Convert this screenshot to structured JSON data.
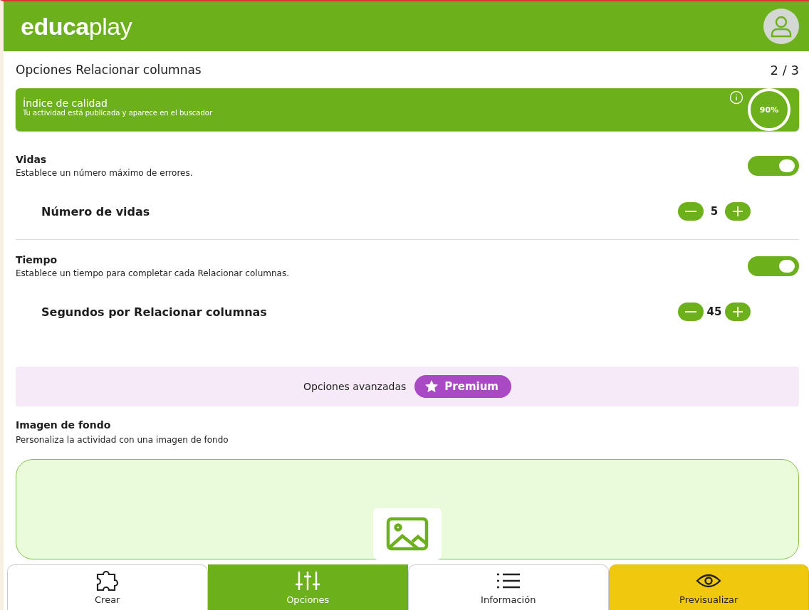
{
  "header": {
    "logo": "**educa**play"
  },
  "page": {
    "title": "Opciones Relacionar columnas",
    "step": "2 / 3"
  },
  "quality": {
    "title": "Índice de calidad",
    "subtitle": "Tu actividad está publicada y aparece en el buscador",
    "percent": "90%"
  },
  "options": [
    {
      "title": "Vidas",
      "description": "Establece un número máximo de errores.",
      "on": true,
      "stepper": {
        "label": "Número de vidas",
        "value": "5"
      }
    },
    {
      "title": "Tiempo",
      "description": "Establece un tiempo para completar cada Relacionar columnas.",
      "on": true,
      "stepper": {
        "label": "Segundos por Relacionar columnas",
        "value": "45"
      }
    }
  ],
  "advanced": {
    "label": "Opciones avanzadas",
    "badge": "Premium"
  },
  "background": {
    "title": "Imagen de fondo",
    "description": "Personaliza la actividad con una imagen de fondo"
  },
  "nav": [
    {
      "label": "Crear",
      "kind": "create",
      "selected": false
    },
    {
      "label": "Opciones",
      "kind": "options",
      "selected": true
    },
    {
      "label": "Información",
      "kind": "info",
      "selected": false
    },
    {
      "label": "Previsualizar",
      "kind": "preview",
      "selected": false
    }
  ]
}
